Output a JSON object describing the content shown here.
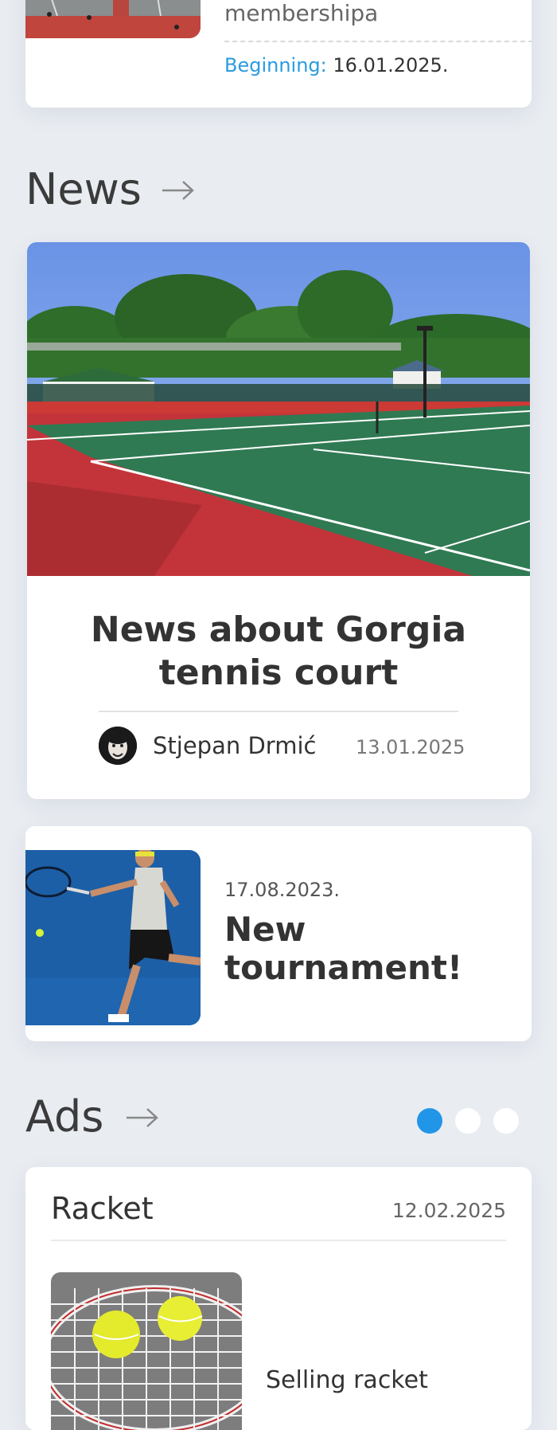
{
  "membership": {
    "title": "membershipa",
    "beginning_label": "Beginning:",
    "beginning_date": "16.01.2025."
  },
  "news_section": {
    "heading": "News",
    "main": {
      "headline": "News about Gorgia tennis court",
      "author": "Stjepan Drmić",
      "date": "13.01.2025"
    },
    "secondary": {
      "date": "17.08.2023.",
      "title": "New tournament!"
    }
  },
  "ads_section": {
    "heading": "Ads",
    "dots": [
      {
        "color": "#2196e9",
        "active": true
      },
      {
        "color": "#ffffff",
        "active": false
      },
      {
        "color": "#ffffff",
        "active": false
      }
    ],
    "ad": {
      "title": "Racket",
      "date": "12.02.2025",
      "description": "Selling racket"
    }
  },
  "colors": {
    "accent": "#2a9bdf",
    "background": "#e9edf2"
  }
}
